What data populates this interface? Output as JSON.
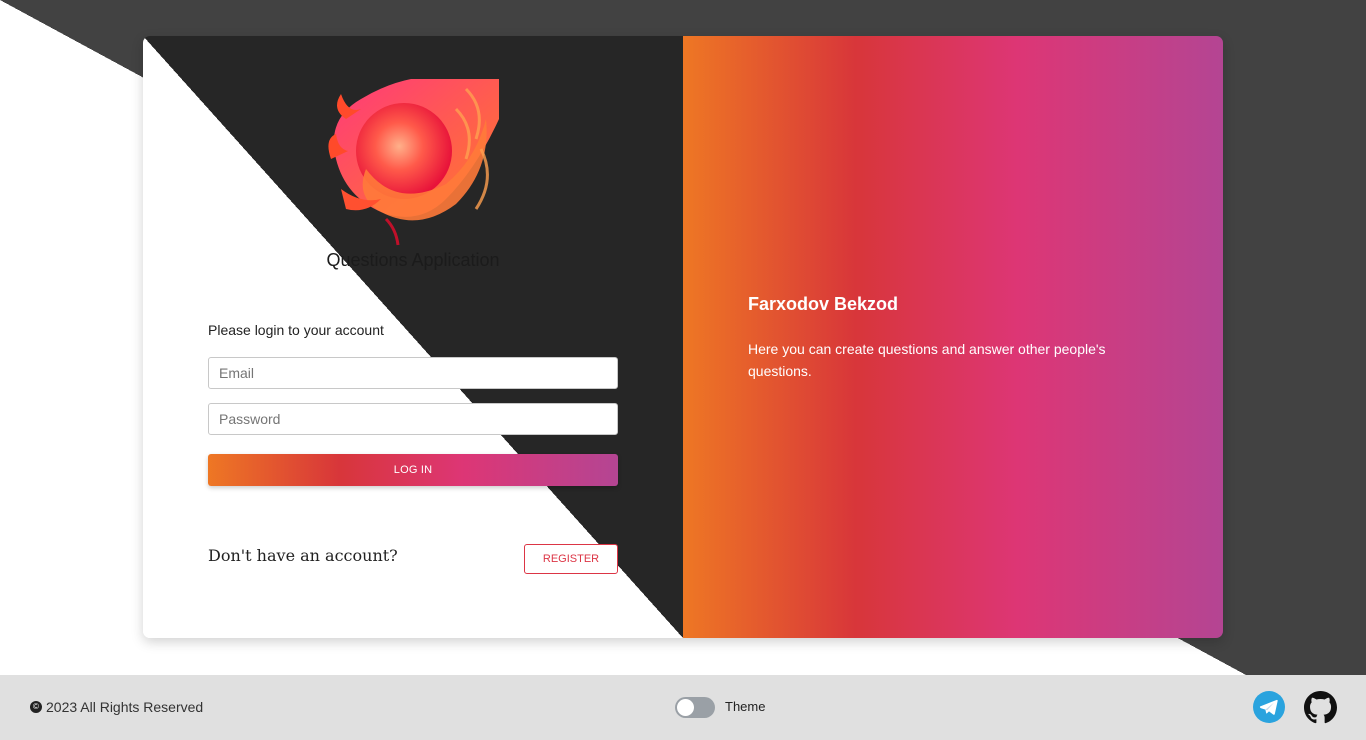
{
  "app": {
    "title": "Questions Application"
  },
  "login": {
    "prompt": "Please login to your account",
    "email_placeholder": "Email",
    "password_placeholder": "Password",
    "login_label": "LOG IN",
    "no_account_text": "Don't have an account?",
    "register_label": "REGISTER"
  },
  "info": {
    "author": "Farxodov Bekzod",
    "description": "Here you can create questions and answer other people's questions."
  },
  "footer": {
    "copyright": "2023 All Rights Reserved",
    "theme_label": "Theme",
    "theme_toggle_on": false,
    "icons": [
      "copyright-icon",
      "telegram-icon",
      "github-icon"
    ]
  },
  "colors": {
    "gradient": [
      "#ee7724",
      "#d8363a",
      "#dd3675",
      "#b44593"
    ],
    "dark": "#262626",
    "register_accent": "#dc3545"
  }
}
